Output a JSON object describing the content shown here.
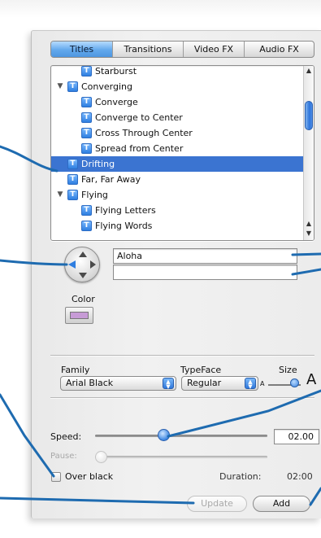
{
  "tabs": [
    {
      "label": "Titles",
      "active": true
    },
    {
      "label": "Transitions",
      "active": false
    },
    {
      "label": "Video FX",
      "active": false
    },
    {
      "label": "Audio FX",
      "active": false
    }
  ],
  "title_list": {
    "items": [
      {
        "label": "Starburst",
        "level": 1,
        "expander": "",
        "selected": false
      },
      {
        "label": "Converging",
        "level": 0,
        "expander": "▼",
        "selected": false
      },
      {
        "label": "Converge",
        "level": 1,
        "expander": "",
        "selected": false
      },
      {
        "label": "Converge to Center",
        "level": 1,
        "expander": "",
        "selected": false
      },
      {
        "label": "Cross Through Center",
        "level": 1,
        "expander": "",
        "selected": false
      },
      {
        "label": "Spread from Center",
        "level": 1,
        "expander": "",
        "selected": false
      },
      {
        "label": "Drifting",
        "level": 0,
        "expander": "",
        "selected": true
      },
      {
        "label": "Far, Far Away",
        "level": 0,
        "expander": "",
        "selected": false
      },
      {
        "label": "Flying",
        "level": 0,
        "expander": "▼",
        "selected": false
      },
      {
        "label": "Flying Letters",
        "level": 1,
        "expander": "",
        "selected": false
      },
      {
        "label": "Flying Words",
        "level": 1,
        "expander": "",
        "selected": false
      }
    ],
    "icon_glyph": "T"
  },
  "text_lines": {
    "line1": "Aloha",
    "line2": ""
  },
  "color": {
    "label": "Color",
    "value": "#c79bd6"
  },
  "font": {
    "family_label": "Family",
    "family_value": "Arial Black",
    "typeface_label": "TypeFace",
    "typeface_value": "Regular",
    "size_label": "Size",
    "size_small_glyph": "A",
    "size_large_glyph": "A",
    "size_level": 0.8
  },
  "timing": {
    "speed_label": "Speed:",
    "speed_value": "02.00",
    "speed_level": 0.4,
    "pause_label": "Pause:",
    "pause_level": 0.0,
    "over_black_label": "Over black",
    "over_black_checked": false,
    "duration_label": "Duration:",
    "duration_value": "02:00"
  },
  "buttons": {
    "update_label": "Update",
    "add_label": "Add"
  },
  "colors": {
    "selection": "#3b74d1",
    "accent": "#2f7ee0",
    "callout_line": "#1e6bb0"
  }
}
